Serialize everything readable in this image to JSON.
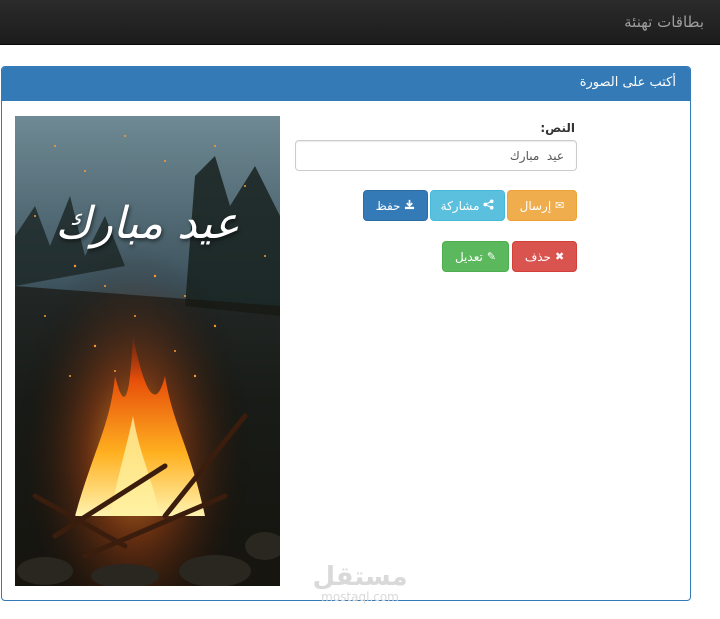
{
  "navbar": {
    "brand": "بطاقات تهنئة"
  },
  "panel": {
    "title": "أكتب على الصورة"
  },
  "card": {
    "overlay_text": "عيد مبارك"
  },
  "form": {
    "text_label": "النص:",
    "text_value": "عيد  مبارك"
  },
  "buttons": {
    "send": {
      "label": "إرسال",
      "icon": "envelope-icon"
    },
    "share": {
      "label": "مشاركة",
      "icon": "share-icon"
    },
    "save": {
      "label": "حفظ",
      "icon": "download-icon"
    },
    "delete": {
      "label": "حذف",
      "icon": "close-icon"
    },
    "edit": {
      "label": "تعديل",
      "icon": "pencil-icon"
    }
  },
  "watermark": {
    "main": "مستقل",
    "sub": "mostaql.com"
  },
  "colors": {
    "navbar": "#1f1f1f",
    "panel_primary": "#337ab7",
    "warning": "#f0ad4e",
    "info": "#5bc0de",
    "danger": "#d9534f",
    "success": "#5cb85c"
  }
}
